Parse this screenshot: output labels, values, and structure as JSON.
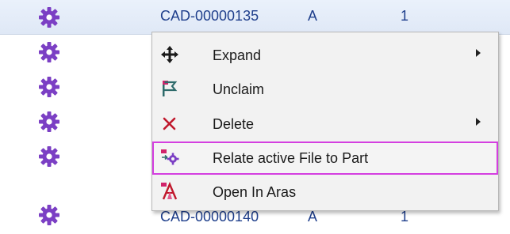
{
  "rows": [
    {
      "name": "CAD-00000135",
      "rev": "A",
      "qty": "1",
      "selected": true
    },
    {
      "name": "",
      "rev": "",
      "qty": ""
    },
    {
      "name": "",
      "rev": "",
      "qty": ""
    },
    {
      "name": "",
      "rev": "",
      "qty": ""
    },
    {
      "name": "",
      "rev": "",
      "qty": ""
    },
    {
      "name": "CAD-00000140",
      "rev": "A",
      "qty": "1"
    }
  ],
  "context_menu": {
    "items": [
      {
        "label": "Expand",
        "icon": "expand-arrows-icon",
        "has_submenu": true
      },
      {
        "label": "Unclaim",
        "icon": "unclaim-flag-icon",
        "has_submenu": false
      },
      {
        "label": "Delete",
        "icon": "delete-x-icon",
        "has_submenu": true
      },
      {
        "label": "Relate active File to Part",
        "icon": "relate-file-part-icon",
        "has_submenu": false,
        "highlighted": true
      },
      {
        "label": "Open In Aras",
        "icon": "aras-logo-icon",
        "has_submenu": false
      }
    ]
  },
  "colors": {
    "gear": "#7b3fc4",
    "link_text": "#1f3f8c",
    "highlight_border": "#d43fe0",
    "menu_bg": "#f2f2f2",
    "selected_row_bg": "#e3ebf7"
  }
}
